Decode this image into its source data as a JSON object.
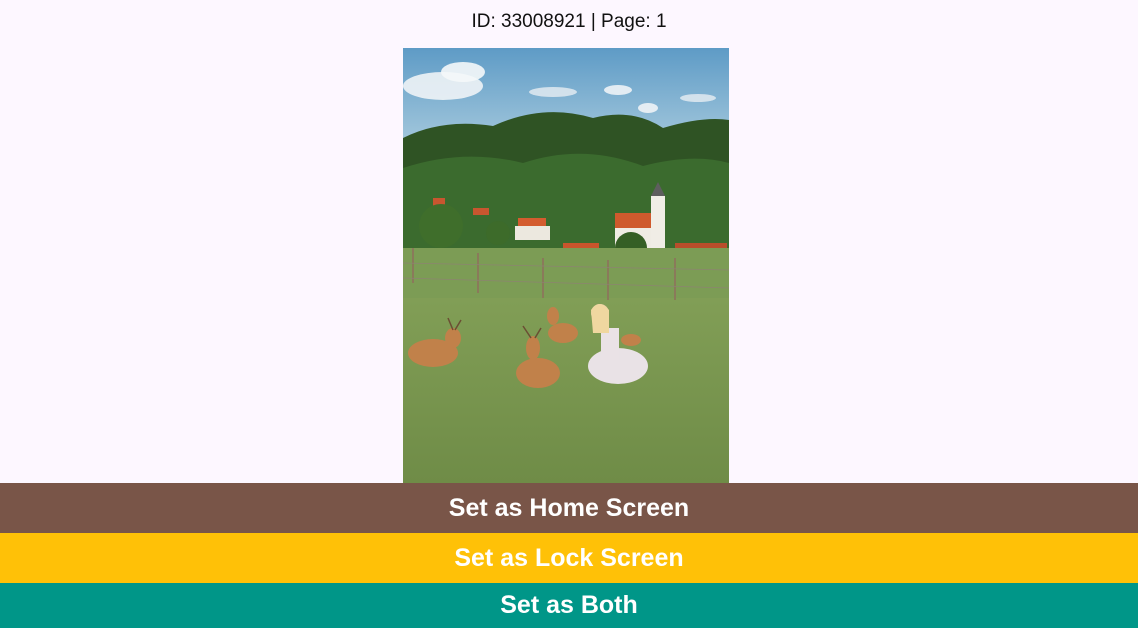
{
  "header": {
    "text": "ID: 33008921 | Page: 1"
  },
  "image": {
    "name": "wallpaper-preview-image"
  },
  "buttons": {
    "home_label": "Set as Home Screen",
    "lock_label": "Set as Lock Screen",
    "both_label": "Set as Both"
  },
  "colors": {
    "background": "#fdf7ff",
    "home_button": "#795548",
    "lock_button": "#ffc107",
    "both_button": "#009688"
  }
}
